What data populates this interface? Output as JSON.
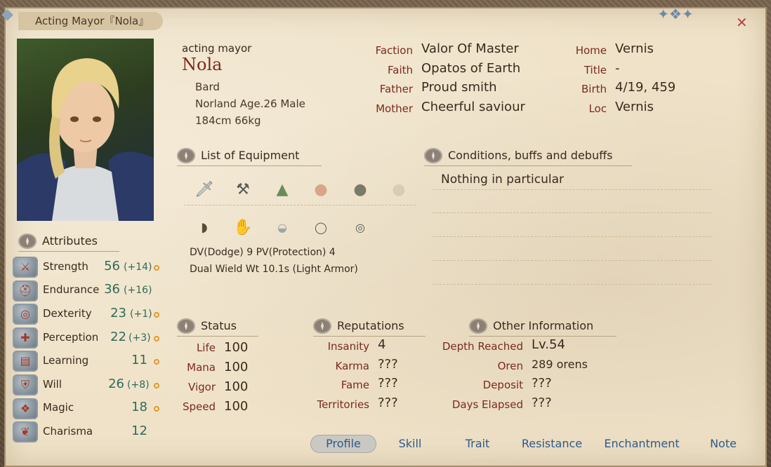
{
  "window": {
    "title": "Acting Mayor『Nola』",
    "close_icon": "close-icon"
  },
  "character": {
    "subtitle": "acting mayor",
    "name": "Nola",
    "class": "Bard",
    "race_age_sex": "Norland Age.26 Male",
    "height_weight": "184cm 66kg"
  },
  "profile_fields": {
    "faction_label": "Faction",
    "faction": "Valor Of Master",
    "faith_label": "Faith",
    "faith": "Opatos of Earth",
    "father_label": "Father",
    "father": "Proud smith",
    "mother_label": "Mother",
    "mother": "Cheerful saviour",
    "home_label": "Home",
    "home": "Vernis",
    "title_label": "Title",
    "title": "-",
    "birth_label": "Birth",
    "birth": "4/19, 459",
    "loc_label": "Loc",
    "loc": "Vernis"
  },
  "equipment": {
    "header": "List of Equipment",
    "row1": [
      "dagger-icon",
      "axe-icon",
      "hat-icon",
      "armor-icon",
      "bag-icon",
      "faded-slot-icon"
    ],
    "row2": [
      "boots-icon",
      "gloves-icon",
      "belt-icon",
      "ring-icon",
      "amulet-icon"
    ],
    "dv_pv": "DV(Dodge) 9   PV(Protection) 4",
    "wield_line": "Dual Wield Wt 10.1s (Light Armor)"
  },
  "conditions": {
    "header": "Conditions, buffs and debuffs",
    "text": "Nothing in particular"
  },
  "attributes": {
    "header": "Attributes",
    "items": [
      {
        "name": "Strength",
        "value": "56",
        "bonus": "(+14)",
        "icon": "sword-icon"
      },
      {
        "name": "Endurance",
        "value": "36",
        "bonus": "(+16)",
        "icon": "helmet-icon"
      },
      {
        "name": "Dexterity",
        "value": "23",
        "bonus": "(+1)",
        "icon": "ring-icon"
      },
      {
        "name": "Perception",
        "value": "22",
        "bonus": "(+3)",
        "icon": "eye-icon"
      },
      {
        "name": "Learning",
        "value": "11",
        "bonus": "",
        "icon": "book-icon"
      },
      {
        "name": "Will",
        "value": "26",
        "bonus": "(+8)",
        "icon": "shield-icon"
      },
      {
        "name": "Magic",
        "value": "18",
        "bonus": "",
        "icon": "rune-icon"
      },
      {
        "name": "Charisma",
        "value": "12",
        "bonus": "",
        "icon": "ribbon-icon"
      }
    ]
  },
  "status": {
    "header": "Status",
    "rows": [
      {
        "label": "Life",
        "value": "100"
      },
      {
        "label": "Mana",
        "value": "100"
      },
      {
        "label": "Vigor",
        "value": "100"
      },
      {
        "label": "Speed",
        "value": "100"
      }
    ]
  },
  "reputations": {
    "header": "Reputations",
    "rows": [
      {
        "label": "Insanity",
        "value": "4"
      },
      {
        "label": "Karma",
        "value": "???"
      },
      {
        "label": "Fame",
        "value": "???"
      },
      {
        "label": "Territories",
        "value": "???"
      }
    ]
  },
  "other": {
    "header": "Other Information",
    "rows": [
      {
        "label": "Depth Reached",
        "value": "Lv.54"
      },
      {
        "label": "Oren",
        "value": "289  orens"
      },
      {
        "label": "Deposit",
        "value": "???"
      },
      {
        "label": "Days Elapsed",
        "value": "???"
      }
    ]
  },
  "tabs": [
    "Profile",
    "Skill",
    "Trait",
    "Resistance",
    "Enchantment",
    "Note"
  ],
  "active_tab": "Profile",
  "colors": {
    "parchment": "#efe2c8",
    "label_red": "#7a2a1e",
    "stat_green": "#2f6a5a",
    "tab_blue": "#2e5a8a",
    "close_red": "#b04848"
  }
}
